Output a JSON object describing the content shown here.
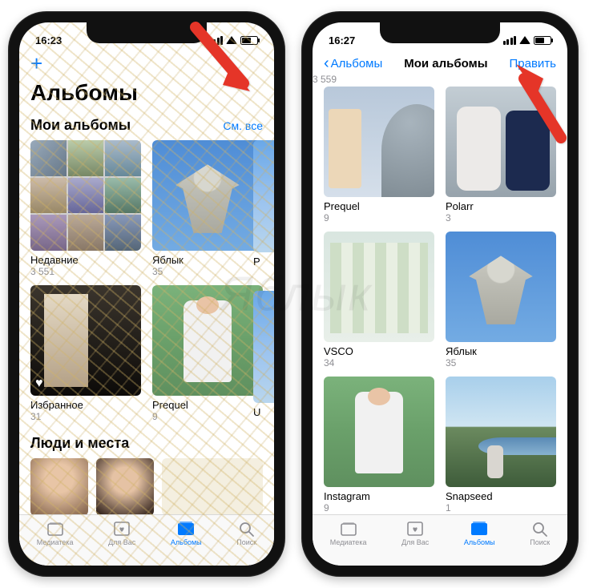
{
  "watermark": "Яблык",
  "left": {
    "time": "16:23",
    "plus": "+",
    "page_title": "Альбомы",
    "section1_title": "Мои альбомы",
    "see_all": "См. все",
    "albums": [
      {
        "name": "Недавние",
        "count": "3 551"
      },
      {
        "name": "Яблык",
        "count": "35"
      },
      {
        "name": "Избранное",
        "count": "31"
      },
      {
        "name": "Prequel",
        "count": "9"
      }
    ],
    "partial_album_letter": "U",
    "section2_title": "Люди и места"
  },
  "right": {
    "time": "16:27",
    "back_label": "Альбомы",
    "nav_title": "Мои альбомы",
    "edit_label": "Править",
    "scroll_count": "3 559",
    "albums": [
      {
        "name": "Prequel",
        "count": "9"
      },
      {
        "name": "Polarr",
        "count": "3"
      },
      {
        "name": "VSCO",
        "count": "34"
      },
      {
        "name": "Яблык",
        "count": "35"
      },
      {
        "name": "Instagram",
        "count": "9"
      },
      {
        "name": "Snapseed",
        "count": "1"
      }
    ]
  },
  "tabs": {
    "library": "Медиатека",
    "foryou": "Для Вас",
    "albums": "Альбомы",
    "search": "Поиск"
  }
}
